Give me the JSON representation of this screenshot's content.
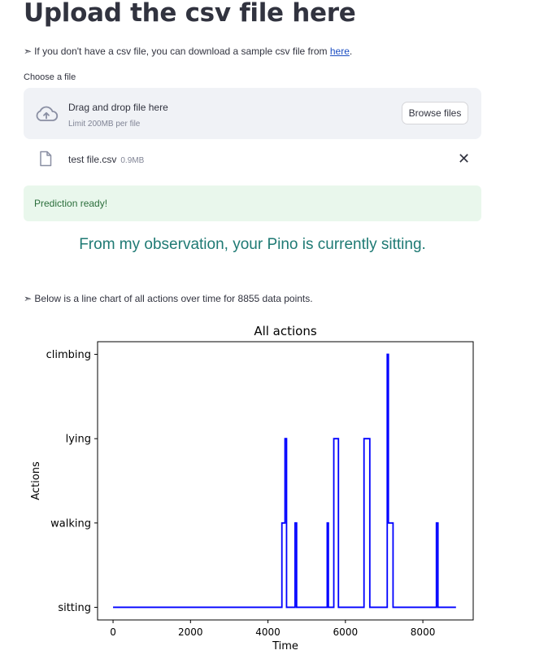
{
  "page": {
    "title": "Upload the csv file here",
    "info": {
      "arrow": "➣",
      "text": "If you don't have a csv file, you can download a sample csv file from ",
      "link_text": "here",
      "suffix": "."
    }
  },
  "uploader": {
    "label": "Choose a file",
    "drop_text": "Drag and drop file here",
    "limit_text": "Limit 200MB per file",
    "browse_label": "Browse files",
    "icon": "cloud-upload-icon"
  },
  "file": {
    "name": "test file.csv",
    "size": "0.9MB",
    "icon": "file-icon",
    "close_glyph": "✕"
  },
  "alert": {
    "text": "Prediction ready!",
    "color": "#e9f7ec"
  },
  "observation": "From my observation, your Pino is currently sitting.",
  "chart_note": {
    "arrow": "➣",
    "text": "Below is a line chart of all actions over time for 8855 data points."
  },
  "chart_data": {
    "type": "line",
    "title": "All actions",
    "xlabel": "Time",
    "ylabel": "Actions",
    "categories": [
      "sitting",
      "walking",
      "lying",
      "climbing"
    ],
    "xlim": [
      -400,
      9300
    ],
    "xticks": [
      0,
      2000,
      4000,
      6000,
      8000
    ],
    "ylim": [
      -0.15,
      3.15
    ],
    "line_color": "#0000ff",
    "grid": false,
    "series": [
      {
        "x": [
          0,
          4360,
          4360,
          4440,
          4440,
          4480,
          4480,
          4700,
          4700,
          4740,
          4740,
          5530,
          5530,
          5560,
          5560,
          5700,
          5700,
          5820,
          5820,
          6480,
          6480,
          6630,
          6630,
          7080,
          7080,
          7110,
          7110,
          7230,
          7230,
          8350,
          8350,
          8390,
          8390,
          8855
        ],
        "y": [
          0,
          0,
          1,
          1,
          2,
          2,
          0,
          0,
          1,
          1,
          0,
          0,
          1,
          1,
          0,
          0,
          2,
          2,
          0,
          0,
          2,
          2,
          0,
          0,
          3,
          3,
          1,
          1,
          0,
          0,
          1,
          1,
          0,
          0
        ]
      }
    ]
  }
}
